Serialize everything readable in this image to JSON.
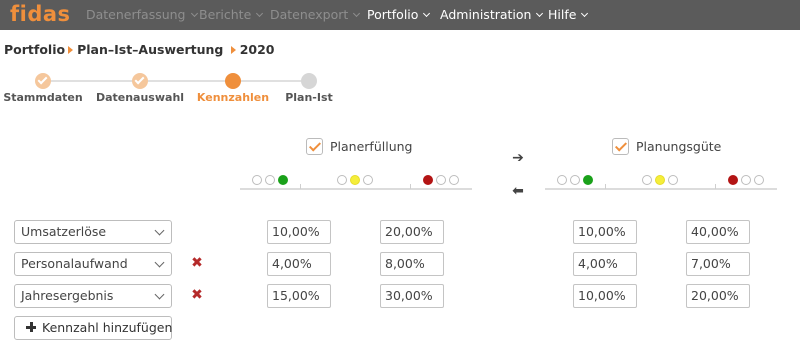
{
  "colors": {
    "accent": "#ef8f3c",
    "nav_bg": "#5b5b5b",
    "green": "#1aa11a",
    "yellow": "#f5ee3a",
    "red": "#b31414"
  },
  "app": {
    "logo": "fidas"
  },
  "nav": {
    "items": [
      {
        "label": "Datenerfassung",
        "active": false
      },
      {
        "label": "Berichte",
        "active": false
      },
      {
        "label": "Datenexport",
        "active": false
      },
      {
        "label": "Portfolio",
        "active": true
      },
      {
        "label": "Administration",
        "active": true
      },
      {
        "label": "Hilfe",
        "active": true
      }
    ]
  },
  "breadcrumb": {
    "part1": "Portfolio",
    "part2": "Plan–Ist–Auswertung",
    "part3": "2020"
  },
  "stepper": {
    "steps": [
      {
        "label": "Stammdaten",
        "state": "done"
      },
      {
        "label": "Datenauswahl",
        "state": "done"
      },
      {
        "label": "Kennzahlen",
        "state": "current"
      },
      {
        "label": "Plan-Ist",
        "state": "todo"
      }
    ]
  },
  "sections": {
    "planerfuellung": {
      "label": "Planerfüllung",
      "checked": true
    },
    "planungsguete": {
      "label": "Planungsgüte",
      "checked": true
    }
  },
  "arrows": {
    "right": "➔",
    "left": "⬅"
  },
  "rows": [
    {
      "metric": "Umsatzerlöse",
      "deletable": false,
      "plan_threshold_1": "10,00%",
      "plan_threshold_2": "20,00%",
      "guete_threshold_1": "10,00%",
      "guete_threshold_2": "40,00%"
    },
    {
      "metric": "Personalaufwand",
      "deletable": true,
      "plan_threshold_1": "4,00%",
      "plan_threshold_2": "8,00%",
      "guete_threshold_1": "4,00%",
      "guete_threshold_2": "7,00%"
    },
    {
      "metric": "Jahresergebnis",
      "deletable": true,
      "plan_threshold_1": "15,00%",
      "plan_threshold_2": "30,00%",
      "guete_threshold_1": "10,00%",
      "guete_threshold_2": "20,00%"
    }
  ],
  "delete_glyph": "✖",
  "add_button": {
    "label": "Kennzahl hinzufügen"
  }
}
